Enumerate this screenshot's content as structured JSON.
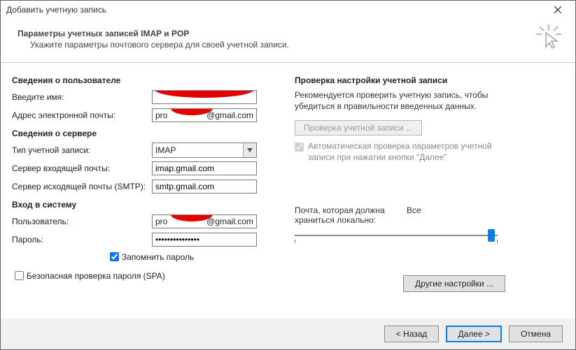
{
  "window_title": "Добавить учетную запись",
  "header": {
    "title": "Параметры учетных записей IMAP и POP",
    "subtitle": "Укажите параметры почтового сервера для своей учетной записи."
  },
  "left": {
    "user_info_title": "Сведения о пользователе",
    "name_label": "Введите имя:",
    "name_value": "",
    "email_label": "Адрес электронной почты:",
    "email_prefix": "pro",
    "email_suffix": "@gmail.com",
    "server_info_title": "Сведения о сервере",
    "account_type_label": "Тип учетной записи:",
    "account_type_value": "IMAP",
    "incoming_label": "Сервер входящей почты:",
    "incoming_value": "imap.gmail.com",
    "outgoing_label": "Сервер исходящей почты (SMTP):",
    "outgoing_value": "smtp.gmail.com",
    "login_title": "Вход в систему",
    "user_label": "Пользователь:",
    "user_prefix": "pro",
    "user_suffix": "@gmail.com",
    "password_label": "Пароль:",
    "password_value": "***************",
    "remember_label": "Запомнить пароль",
    "spa_label": "Безопасная проверка пароля (SPA)"
  },
  "right": {
    "test_title": "Проверка настройки учетной записи",
    "test_desc": "Рекомендуется проверить учетную запись, чтобы убедиться в правильности введенных данных.",
    "test_button": "Проверка учетной записи ...",
    "auto_test_label": "Автоматическая проверка параметров учетной записи при нажатии кнопки \"Далее\"",
    "slider_left": "Почта, которая должна храниться локально:",
    "slider_right": "Все",
    "other_settings": "Другие настройки ..."
  },
  "footer": {
    "back": "< Назад",
    "next": "Далее >",
    "cancel": "Отмена"
  }
}
